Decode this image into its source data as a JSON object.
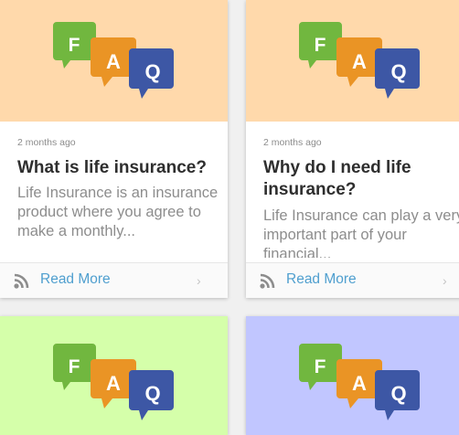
{
  "colors": {
    "thumb_peach": "#ffd9ab",
    "thumb_green": "#d5ffaa",
    "thumb_lavender": "#c1c6ff",
    "bubble_f": "#71b73f",
    "bubble_a": "#ea9425",
    "bubble_q": "#3d57a5",
    "link": "#4f9fcf"
  },
  "faq_logo": {
    "letters": [
      "F",
      "A",
      "Q"
    ]
  },
  "cards": [
    {
      "date": "2 months ago",
      "title": "What is life insurance?",
      "excerpt": "Life Insurance is an insurance product where you agree to make a monthly...",
      "read_more": "Read More",
      "rss_icon": "rss-icon",
      "arrow_icon": "chevron-right-icon"
    },
    {
      "date": "2 months ago",
      "title": "Why do I need life insurance?",
      "excerpt": "Life Insurance can play a very important part of your financial...",
      "read_more": "Read More",
      "rss_icon": "rss-icon",
      "arrow_icon": "chevron-right-icon"
    },
    {},
    {}
  ]
}
